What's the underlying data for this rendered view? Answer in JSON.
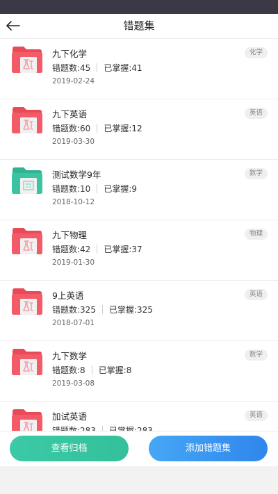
{
  "header": {
    "title": "错题集"
  },
  "colors": {
    "red_folder": "#f25b67",
    "green_folder": "#3cc4a2",
    "archive_button": "#3ccaa6",
    "add_button": "#3a93ef"
  },
  "items": [
    {
      "name": "九下化学",
      "wrong_label": "错题数:45",
      "mastered_label": "已掌握:41",
      "date": "2019-02-24",
      "tag": "化学",
      "folder_color": "red",
      "folder_icon": "flask-icon"
    },
    {
      "name": "九下英语",
      "wrong_label": "错题数:60",
      "mastered_label": "已掌握:12",
      "date": "2019-03-30",
      "tag": "英语",
      "folder_color": "red",
      "folder_icon": "flask-icon"
    },
    {
      "name": "测试数学9年",
      "wrong_label": "错题数:10",
      "mastered_label": "已掌握:9",
      "date": "2018-10-12",
      "tag": "数学",
      "folder_color": "green",
      "folder_icon": "calculator-icon"
    },
    {
      "name": "九下物理",
      "wrong_label": "错题数:42",
      "mastered_label": "已掌握:37",
      "date": "2019-01-30",
      "tag": "物理",
      "folder_color": "red",
      "folder_icon": "flask-icon"
    },
    {
      "name": "9上英语",
      "wrong_label": "错题数:325",
      "mastered_label": "已掌握:325",
      "date": "2018-07-01",
      "tag": "英语",
      "folder_color": "red",
      "folder_icon": "flask-icon"
    },
    {
      "name": "九下数学",
      "wrong_label": "错题数:8",
      "mastered_label": "已掌握:8",
      "date": "2019-03-08",
      "tag": "数学",
      "folder_color": "red",
      "folder_icon": "flask-icon"
    },
    {
      "name": "加试英语",
      "wrong_label": "错题数:283",
      "mastered_label": "已掌握:283",
      "date": "",
      "tag": "英语",
      "folder_color": "red",
      "folder_icon": "flask-icon"
    }
  ],
  "footer": {
    "archive_label": "查看归档",
    "add_label": "添加错题集"
  }
}
